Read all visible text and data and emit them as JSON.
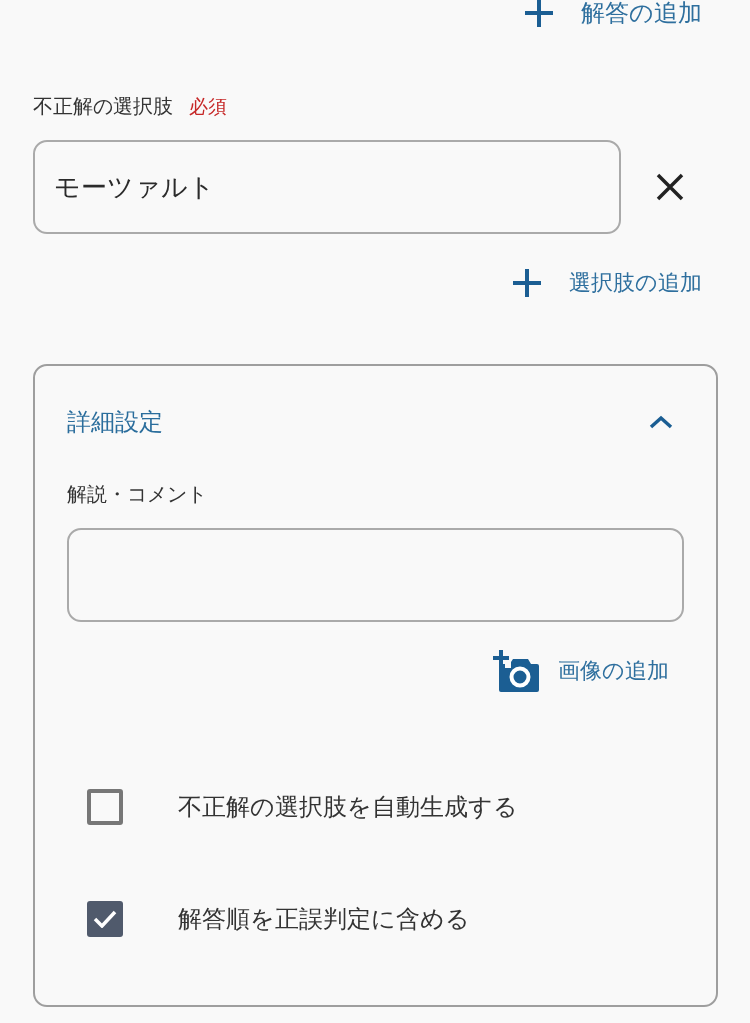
{
  "answer_add": {
    "label": "解答の追加"
  },
  "wrong_choices": {
    "label": "不正解の選択肢",
    "required": "必須",
    "items": [
      {
        "value": "モーツァルト"
      }
    ],
    "add_label": "選択肢の追加"
  },
  "advanced": {
    "title": "詳細設定",
    "expanded": true,
    "comment": {
      "label": "解説・コメント"
    },
    "image_add": "画像の追加",
    "options": [
      {
        "label": "不正解の選択肢を自動生成する",
        "checked": false
      },
      {
        "label": "解答順を正誤判定に含める",
        "checked": true
      }
    ]
  }
}
